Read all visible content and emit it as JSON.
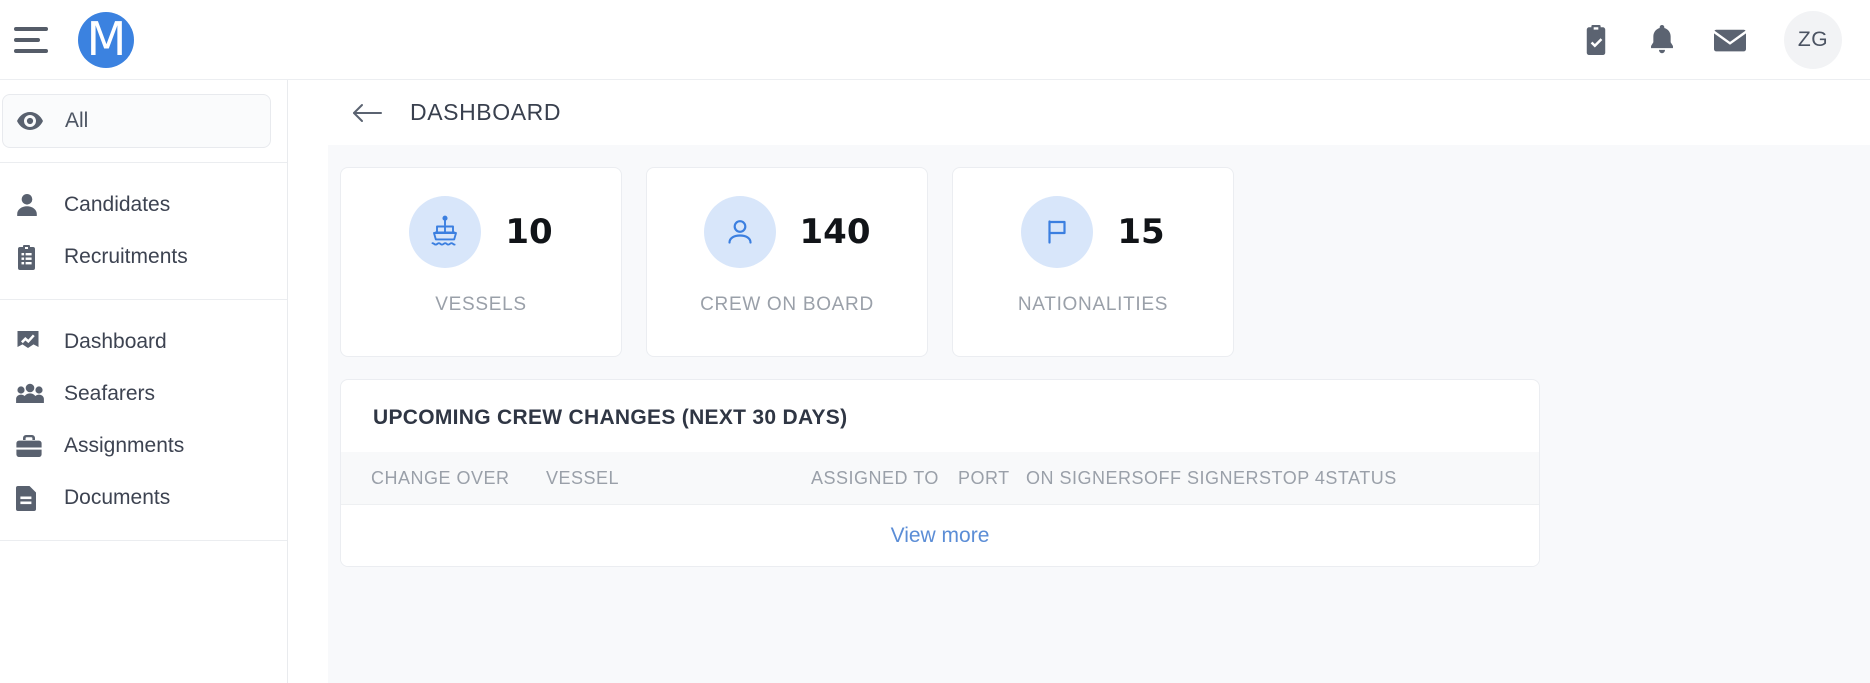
{
  "brand": {
    "logo_letter": "M",
    "accent": "#3b82e0"
  },
  "topbar": {
    "menu_icon": "hamburger-icon",
    "icons": [
      {
        "name": "clipboard-check-icon",
        "label": "Tasks"
      },
      {
        "name": "bell-icon",
        "label": "Notifications"
      },
      {
        "name": "envelope-icon",
        "label": "Messages"
      }
    ],
    "avatar_initials": "ZG"
  },
  "sidebar": {
    "groups": [
      {
        "items": [
          {
            "label": "All",
            "icon": "eye-icon",
            "selected": true
          }
        ]
      },
      {
        "items": [
          {
            "label": "Candidates",
            "icon": "person-icon",
            "selected": false
          },
          {
            "label": "Recruitments",
            "icon": "clipboard-list-icon",
            "selected": false
          }
        ]
      },
      {
        "items": [
          {
            "label": "Dashboard",
            "icon": "chart-flag-icon",
            "selected": false
          },
          {
            "label": "Seafarers",
            "icon": "people-group-icon",
            "selected": false
          },
          {
            "label": "Assignments",
            "icon": "briefcase-icon",
            "selected": false
          },
          {
            "label": "Documents",
            "icon": "document-icon",
            "selected": false
          }
        ]
      }
    ]
  },
  "page": {
    "back_icon": "arrow-left-icon",
    "title": "DASHBOARD"
  },
  "stats": [
    {
      "icon": "ship-icon",
      "value": "10",
      "label": "VESSELS"
    },
    {
      "icon": "person-icon",
      "value": "140",
      "label": "CREW ON BOARD"
    },
    {
      "icon": "flag-icon",
      "value": "15",
      "label": "NATIONALITIES"
    }
  ],
  "panel": {
    "title": "UPCOMING CREW CHANGES (NEXT 30 DAYS)",
    "columns": [
      "CHANGE OVER",
      "VESSEL",
      "ASSIGNED TO",
      "PORT",
      "ON SIGNERS",
      "OFF SIGNERS",
      "TOP 4",
      "STATUS"
    ],
    "rows": [],
    "view_more_label": "View more"
  }
}
